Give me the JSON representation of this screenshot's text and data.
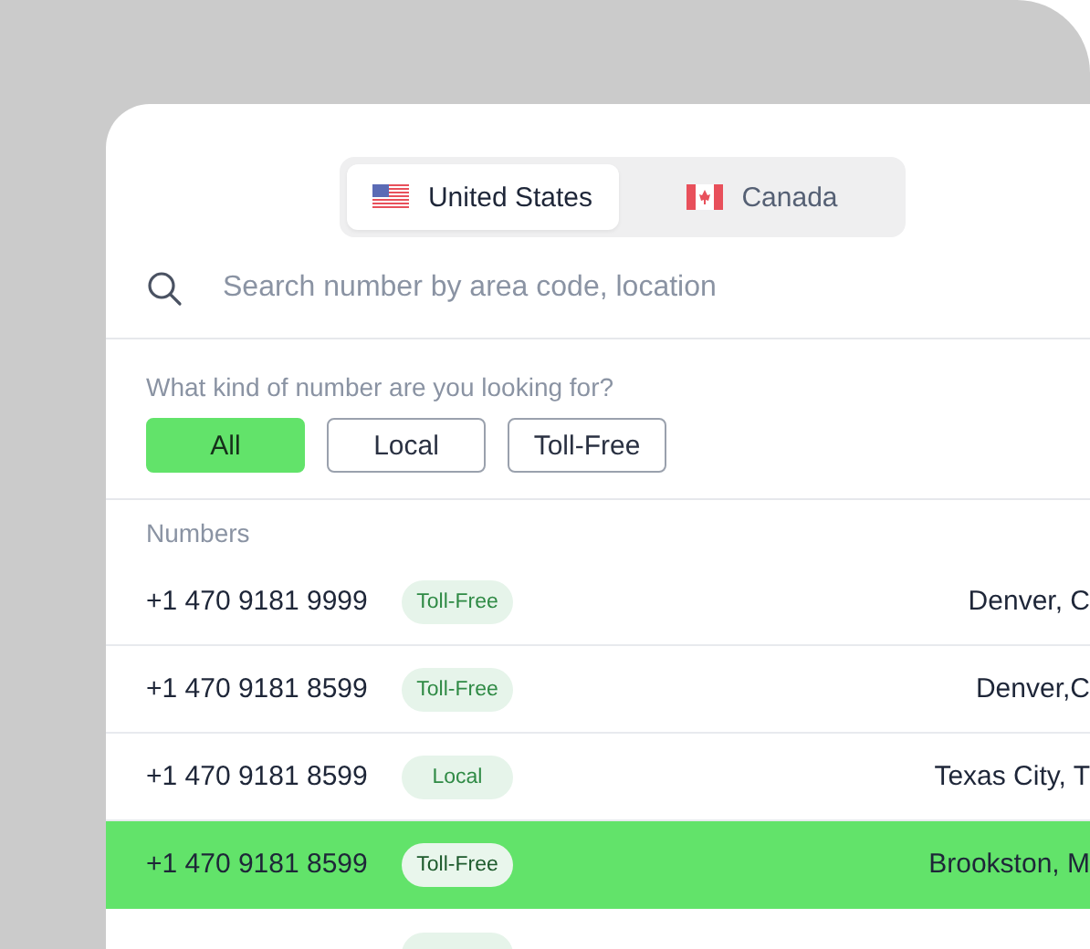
{
  "countries": [
    {
      "label": "United States",
      "kind": "us",
      "selected": true
    },
    {
      "label": "Canada",
      "kind": "ca",
      "selected": false
    }
  ],
  "search": {
    "placeholder": "Search number by area code, location"
  },
  "filter": {
    "question": "What kind of number are you looking for?",
    "options": [
      {
        "label": "All",
        "selected": true
      },
      {
        "label": "Local",
        "selected": false
      },
      {
        "label": "Toll-Free",
        "selected": false
      }
    ]
  },
  "numbers": {
    "heading": "Numbers",
    "rows": [
      {
        "number": "+1 470 9181 9999",
        "type": "Toll-Free",
        "location": "Denver, C",
        "selected": false
      },
      {
        "number": "+1 470 9181 8599",
        "type": "Toll-Free",
        "location": "Denver,C",
        "selected": false
      },
      {
        "number": "+1 470 9181 8599",
        "type": "Local",
        "location": "Texas City, T",
        "selected": false
      },
      {
        "number": "+1 470 9181 8599",
        "type": "Toll-Free",
        "location": "Brookston, M",
        "selected": true
      },
      {
        "selected": false
      }
    ]
  }
}
